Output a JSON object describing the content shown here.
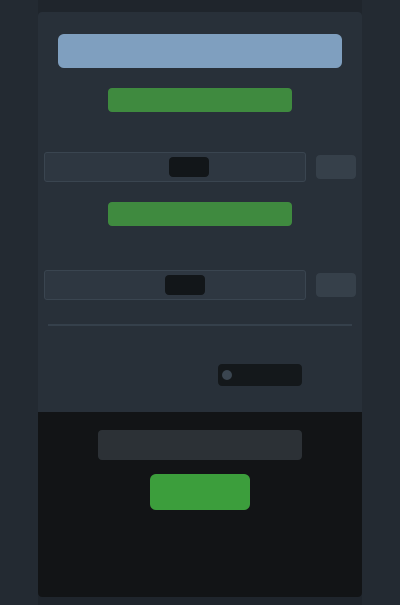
{
  "header": {
    "title": ""
  },
  "swap": {
    "from_label": "",
    "from_sub": "",
    "from_value": "",
    "from_button": "",
    "to_label": "",
    "to_sub": "",
    "to_value": "",
    "to_button": ""
  },
  "option": {
    "label": ""
  },
  "confirm": {
    "title": "",
    "button_label": "",
    "sub": "",
    "footer": ""
  },
  "colors": {
    "background": "#1f252c",
    "header_bar": "#7f9fbf",
    "accent_green": "#3c9e3c",
    "dark_section": "#121416"
  }
}
